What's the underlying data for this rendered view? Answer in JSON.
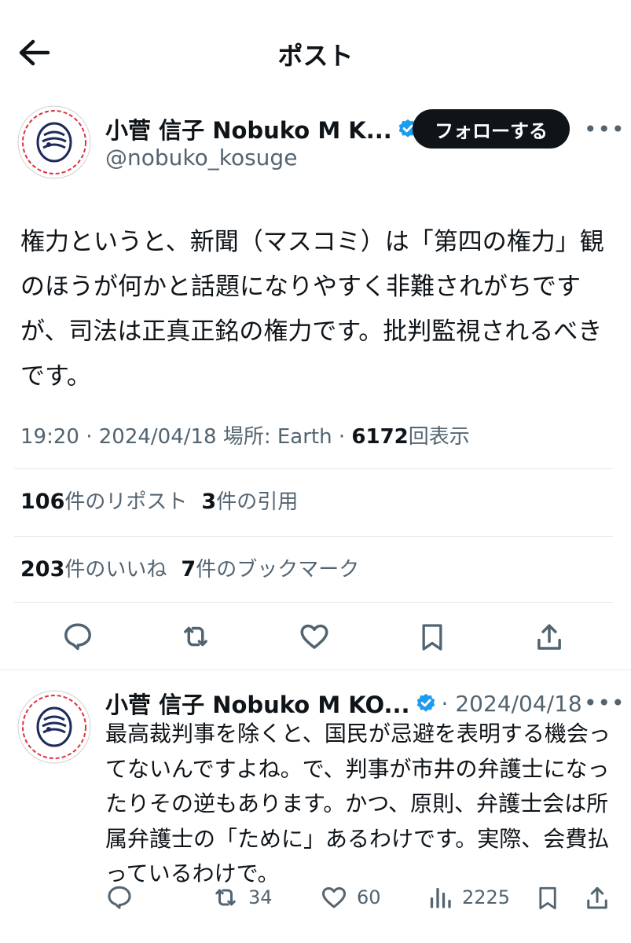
{
  "header": {
    "title": "ポスト"
  },
  "post": {
    "author_name": "小菅 信子 Nobuko M K...",
    "handle": "@nobuko_kosuge",
    "follow_label": "フォローする",
    "text": "権力というと、新聞（マスコミ）は「第四の権力」観のほうが何かと話題になりやすく非難されがちですが、司法は正真正銘の権力です。批判監視されるべきです。",
    "time": "19:20",
    "date": "2024/04/18",
    "location": "場所: Earth",
    "views": "6172",
    "views_label": "回表示",
    "reposts": "106",
    "reposts_label": "件のリポスト",
    "quotes": "3",
    "quotes_label": "件の引用",
    "likes": "203",
    "likes_label": "件のいいね",
    "bookmarks": "7",
    "bookmarks_label": "件のブックマーク"
  },
  "reply": {
    "author_name": "小菅 信子 Nobuko M KO...",
    "date": "· 2024/04/18",
    "text": "最高裁判事を除くと、国民が忌避を表明する機会ってないんですよね。で、判事が市井の弁護士になったりその逆もあります。かつ、原則、弁護士会は所属弁護士の「ために」あるわけです。実際、会費払っているわけで。",
    "reposts": "34",
    "likes": "60",
    "views": "2225"
  },
  "colors": {
    "verified": "#1d9bf0",
    "muted": "#536471",
    "text": "#0f1419"
  },
  "icons": [
    "back-arrow-icon",
    "verified-badge-icon",
    "more-icon",
    "reply-icon",
    "repost-icon",
    "like-icon",
    "bookmark-icon",
    "share-icon",
    "views-icon"
  ]
}
